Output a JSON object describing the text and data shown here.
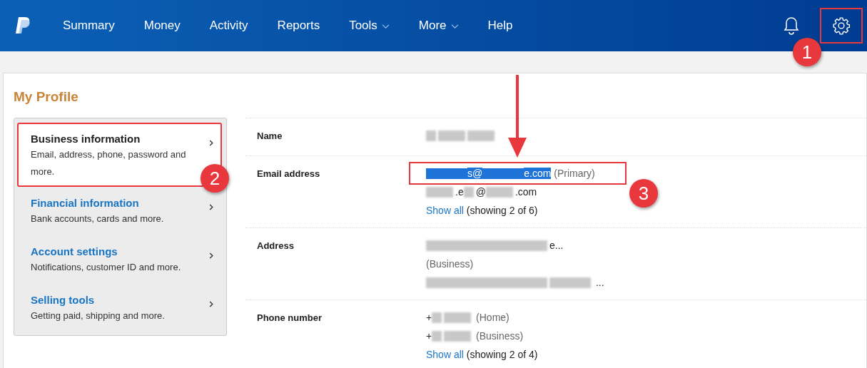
{
  "nav": {
    "items": [
      {
        "label": "Summary",
        "dropdown": false
      },
      {
        "label": "Money",
        "dropdown": false
      },
      {
        "label": "Activity",
        "dropdown": false
      },
      {
        "label": "Reports",
        "dropdown": false
      },
      {
        "label": "Tools",
        "dropdown": true
      },
      {
        "label": "More",
        "dropdown": true
      },
      {
        "label": "Help",
        "dropdown": false
      }
    ],
    "settings_highlighted": true,
    "settings_badge": "1"
  },
  "page_title": "My Profile",
  "sidebar": {
    "items": [
      {
        "title": "Business information",
        "description": "Email, address, phone, password and more.",
        "selected": true,
        "highlighted": true,
        "badge": "2"
      },
      {
        "title": "Financial information",
        "description": "Bank accounts, cards and more.",
        "selected": false,
        "highlighted": false
      },
      {
        "title": "Account settings",
        "description": "Notifications, customer ID and more.",
        "selected": false,
        "highlighted": false
      },
      {
        "title": "Selling tools",
        "description": "Getting paid, shipping and more.",
        "selected": false,
        "highlighted": false
      }
    ]
  },
  "profile": {
    "arrow": true,
    "rows": [
      {
        "label": "Name",
        "lines": [
          {
            "highlighted": false,
            "text_selected": false,
            "segments": [
              {
                "kind": "blur_short"
              },
              {
                "kind": "blur"
              },
              {
                "kind": "blur"
              }
            ]
          }
        ]
      },
      {
        "label": "Email address",
        "lines": [
          {
            "highlighted": true,
            "text_selected": true,
            "badge": "3",
            "segments": [
              {
                "kind": "blur_long"
              },
              {
                "kind": "text",
                "text": "s@"
              },
              {
                "kind": "blur_long"
              },
              {
                "kind": "text",
                "text": "e.com"
              },
              {
                "kind": "note",
                "text": " (Primary)"
              }
            ]
          },
          {
            "highlighted": false,
            "text_selected": false,
            "segments": [
              {
                "kind": "blur"
              },
              {
                "kind": "text",
                "text": ".e"
              },
              {
                "kind": "blur_short"
              },
              {
                "kind": "text",
                "text": "@"
              },
              {
                "kind": "blur"
              },
              {
                "kind": "text",
                "text": ".com"
              }
            ]
          },
          {
            "highlighted": false,
            "text_selected": false,
            "segments": [
              {
                "kind": "link",
                "text": "Show all"
              },
              {
                "kind": "text",
                "text": " (showing 2 of 6)"
              }
            ]
          }
        ]
      },
      {
        "label": "Address",
        "lines": [
          {
            "highlighted": false,
            "text_selected": false,
            "segments": [
              {
                "kind": "blur_xlong"
              },
              {
                "kind": "text",
                "text": "e..."
              }
            ]
          },
          {
            "highlighted": false,
            "text_selected": false,
            "segments": [
              {
                "kind": "note",
                "text": "(Business)"
              }
            ]
          },
          {
            "highlighted": false,
            "text_selected": false,
            "segments": [
              {
                "kind": "blur_xlong"
              },
              {
                "kind": "blur_long"
              },
              {
                "kind": "text",
                "text": " ..."
              }
            ]
          }
        ]
      },
      {
        "label": "Phone number",
        "lines": [
          {
            "highlighted": false,
            "text_selected": false,
            "segments": [
              {
                "kind": "text",
                "text": "+"
              },
              {
                "kind": "blur_short"
              },
              {
                "kind": "blur"
              },
              {
                "kind": "note",
                "text": " (Home)"
              }
            ]
          },
          {
            "highlighted": false,
            "text_selected": false,
            "segments": [
              {
                "kind": "text",
                "text": "+"
              },
              {
                "kind": "blur_short"
              },
              {
                "kind": "blur"
              },
              {
                "kind": "note",
                "text": " (Business)"
              }
            ]
          },
          {
            "highlighted": false,
            "text_selected": false,
            "segments": [
              {
                "kind": "link",
                "text": "Show all"
              },
              {
                "kind": "text",
                "text": " (showing 2 of 4)"
              }
            ]
          }
        ]
      }
    ]
  }
}
